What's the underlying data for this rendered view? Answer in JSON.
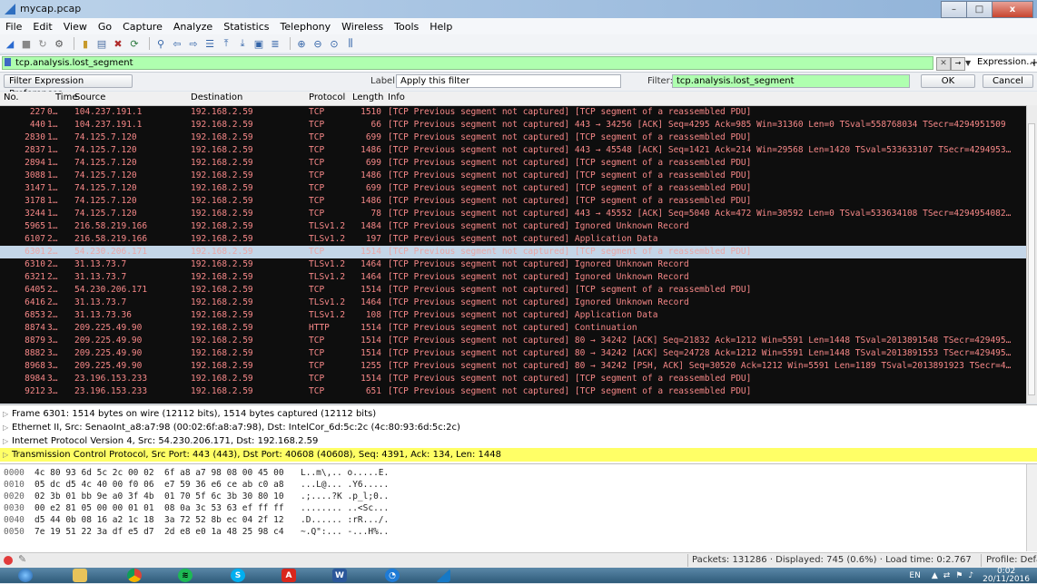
{
  "window": {
    "title": "mycap.pcap",
    "minimize": "–",
    "maximize": "□",
    "close": "x"
  },
  "menu": [
    "File",
    "Edit",
    "View",
    "Go",
    "Capture",
    "Analyze",
    "Statistics",
    "Telephony",
    "Wireless",
    "Tools",
    "Help"
  ],
  "display_filter": {
    "value": "tcp.analysis.lost_segment",
    "expression_label": "Expression...",
    "add_label": "+"
  },
  "filter_expression_bar": {
    "prefs_button": "Filter Expression Preferences...",
    "label_caption": "Label:",
    "label_value": "Apply this filter",
    "filter_caption": "Filter:",
    "filter_value": "tcp.analysis.lost_segment",
    "ok": "OK",
    "cancel": "Cancel"
  },
  "packet_list": {
    "columns": [
      "No.",
      "Time",
      "Source",
      "Destination",
      "Protocol",
      "Length",
      "Info"
    ],
    "rows": [
      {
        "no": "227",
        "time": "0…",
        "src": "104.237.191.1",
        "dst": "192.168.2.59",
        "proto": "TCP",
        "len": "1510",
        "info": "[TCP Previous segment not captured] [TCP segment of a reassembled PDU]"
      },
      {
        "no": "440",
        "time": "1…",
        "src": "104.237.191.1",
        "dst": "192.168.2.59",
        "proto": "TCP",
        "len": "66",
        "info": "[TCP Previous segment not captured] 443 → 34256 [ACK] Seq=4295 Ack=985 Win=31360 Len=0 TSval=558768034 TSecr=4294951509"
      },
      {
        "no": "2830",
        "time": "1…",
        "src": "74.125.7.120",
        "dst": "192.168.2.59",
        "proto": "TCP",
        "len": "699",
        "info": "[TCP Previous segment not captured] [TCP segment of a reassembled PDU]"
      },
      {
        "no": "2837",
        "time": "1…",
        "src": "74.125.7.120",
        "dst": "192.168.2.59",
        "proto": "TCP",
        "len": "1486",
        "info": "[TCP Previous segment not captured] 443 → 45548 [ACK] Seq=1421 Ack=214 Win=29568 Len=1420 TSval=533633107 TSecr=4294953…"
      },
      {
        "no": "2894",
        "time": "1…",
        "src": "74.125.7.120",
        "dst": "192.168.2.59",
        "proto": "TCP",
        "len": "699",
        "info": "[TCP Previous segment not captured] [TCP segment of a reassembled PDU]"
      },
      {
        "no": "3088",
        "time": "1…",
        "src": "74.125.7.120",
        "dst": "192.168.2.59",
        "proto": "TCP",
        "len": "1486",
        "info": "[TCP Previous segment not captured] [TCP segment of a reassembled PDU]"
      },
      {
        "no": "3147",
        "time": "1…",
        "src": "74.125.7.120",
        "dst": "192.168.2.59",
        "proto": "TCP",
        "len": "699",
        "info": "[TCP Previous segment not captured] [TCP segment of a reassembled PDU]"
      },
      {
        "no": "3178",
        "time": "1…",
        "src": "74.125.7.120",
        "dst": "192.168.2.59",
        "proto": "TCP",
        "len": "1486",
        "info": "[TCP Previous segment not captured] [TCP segment of a reassembled PDU]"
      },
      {
        "no": "3244",
        "time": "1…",
        "src": "74.125.7.120",
        "dst": "192.168.2.59",
        "proto": "TCP",
        "len": "78",
        "info": "[TCP Previous segment not captured] 443 → 45552 [ACK] Seq=5040 Ack=472 Win=30592 Len=0 TSval=533634108 TSecr=4294954082…"
      },
      {
        "no": "5965",
        "time": "1…",
        "src": "216.58.219.166",
        "dst": "192.168.2.59",
        "proto": "TLSv1.2",
        "len": "1484",
        "info": "[TCP Previous segment not captured] Ignored Unknown Record"
      },
      {
        "no": "6107",
        "time": "2…",
        "src": "216.58.219.166",
        "dst": "192.168.2.59",
        "proto": "TLSv1.2",
        "len": "197",
        "info": "[TCP Previous segment not captured] Application Data"
      },
      {
        "no": "6301",
        "time": "2…",
        "src": "54.230.206.171",
        "dst": "192.168.2.59",
        "proto": "TCP",
        "len": "1514",
        "info": "[TCP Previous segment not captured] [TCP segment of a reassembled PDU]",
        "selected": true
      },
      {
        "no": "6310",
        "time": "2…",
        "src": "31.13.73.7",
        "dst": "192.168.2.59",
        "proto": "TLSv1.2",
        "len": "1464",
        "info": "[TCP Previous segment not captured] Ignored Unknown Record"
      },
      {
        "no": "6321",
        "time": "2…",
        "src": "31.13.73.7",
        "dst": "192.168.2.59",
        "proto": "TLSv1.2",
        "len": "1464",
        "info": "[TCP Previous segment not captured] Ignored Unknown Record"
      },
      {
        "no": "6405",
        "time": "2…",
        "src": "54.230.206.171",
        "dst": "192.168.2.59",
        "proto": "TCP",
        "len": "1514",
        "info": "[TCP Previous segment not captured] [TCP segment of a reassembled PDU]"
      },
      {
        "no": "6416",
        "time": "2…",
        "src": "31.13.73.7",
        "dst": "192.168.2.59",
        "proto": "TLSv1.2",
        "len": "1464",
        "info": "[TCP Previous segment not captured] Ignored Unknown Record"
      },
      {
        "no": "6853",
        "time": "2…",
        "src": "31.13.73.36",
        "dst": "192.168.2.59",
        "proto": "TLSv1.2",
        "len": "108",
        "info": "[TCP Previous segment not captured] Application Data"
      },
      {
        "no": "8874",
        "time": "3…",
        "src": "209.225.49.90",
        "dst": "192.168.2.59",
        "proto": "HTTP",
        "len": "1514",
        "info": "[TCP Previous segment not captured] Continuation"
      },
      {
        "no": "8879",
        "time": "3…",
        "src": "209.225.49.90",
        "dst": "192.168.2.59",
        "proto": "TCP",
        "len": "1514",
        "info": "[TCP Previous segment not captured] 80 → 34242 [ACK] Seq=21832 Ack=1212 Win=5591 Len=1448 TSval=2013891548 TSecr=429495…"
      },
      {
        "no": "8882",
        "time": "3…",
        "src": "209.225.49.90",
        "dst": "192.168.2.59",
        "proto": "TCP",
        "len": "1514",
        "info": "[TCP Previous segment not captured] 80 → 34242 [ACK] Seq=24728 Ack=1212 Win=5591 Len=1448 TSval=2013891553 TSecr=429495…"
      },
      {
        "no": "8968",
        "time": "3…",
        "src": "209.225.49.90",
        "dst": "192.168.2.59",
        "proto": "TCP",
        "len": "1255",
        "info": "[TCP Previous segment not captured] 80 → 34242 [PSH, ACK] Seq=30520 Ack=1212 Win=5591 Len=1189 TSval=2013891923 TSecr=4…"
      },
      {
        "no": "8984",
        "time": "3…",
        "src": "23.196.153.233",
        "dst": "192.168.2.59",
        "proto": "TCP",
        "len": "1514",
        "info": "[TCP Previous segment not captured] [TCP segment of a reassembled PDU]"
      },
      {
        "no": "9212",
        "time": "3…",
        "src": "23.196.153.233",
        "dst": "192.168.2.59",
        "proto": "TCP",
        "len": "651",
        "info": "[TCP Previous segment not captured] [TCP segment of a reassembled PDU]"
      }
    ]
  },
  "details": [
    {
      "text": "Frame 6301: 1514 bytes on wire (12112 bits), 1514 bytes captured (12112 bits)"
    },
    {
      "text": "Ethernet II, Src: SenaoInt_a8:a7:98 (00:02:6f:a8:a7:98), Dst: IntelCor_6d:5c:2c (4c:80:93:6d:5c:2c)"
    },
    {
      "text": "Internet Protocol Version 4, Src: 54.230.206.171, Dst: 192.168.2.59"
    },
    {
      "text": "Transmission Control Protocol, Src Port: 443 (443), Dst Port: 40608 (40608), Seq: 4391, Ack: 134, Len: 1448",
      "highlight": true
    }
  ],
  "bytes": [
    {
      "off": "0000",
      "hex": "4c 80 93 6d 5c 2c 00 02  6f a8 a7 98 08 00 45 00",
      "ascii": "L..m\\,.. o.....E."
    },
    {
      "off": "0010",
      "hex": "05 dc d5 4c 40 00 f0 06  e7 59 36 e6 ce ab c0 a8",
      "ascii": "...L@... .Y6....."
    },
    {
      "off": "0020",
      "hex": "02 3b 01 bb 9e a0 3f 4b  01 70 5f 6c 3b 30 80 10",
      "ascii": ".;....?K .p_l;0.."
    },
    {
      "off": "0030",
      "hex": "00 e2 81 05 00 00 01 01  08 0a 3c 53 63 ef ff ff",
      "ascii": "........ ..<Sc..."
    },
    {
      "off": "0040",
      "hex": "d5 44 0b 08 16 a2 1c 18  3a 72 52 8b ec 04 2f 12",
      "ascii": ".D...... :rR.../."
    },
    {
      "off": "0050",
      "hex": "7e 19 51 22 3a df e5 d7  2d e8 e0 1a 48 25 98 c4",
      "ascii": "~.Q\":... -...H%.."
    }
  ],
  "status": {
    "stats": "Packets: 131286 · Displayed: 745 (0.6%) · Load time: 0:2.767",
    "profile": "Profile: Default"
  },
  "taskbar": {
    "lang": "EN",
    "time": "0:02",
    "date": "20/11/2016",
    "apps": [
      "windows-start-icon",
      "file-explorer-icon",
      "chrome-icon",
      "spotify-icon",
      "skype-icon",
      "acrobat-icon",
      "word-icon",
      "app-circle-icon",
      "wireshark-icon"
    ]
  },
  "colors": {
    "row_text": "#f78888",
    "row_bg": "#0e0e0e",
    "filter_ok": "#afffaf",
    "detail_highlight": "#ffff66"
  }
}
